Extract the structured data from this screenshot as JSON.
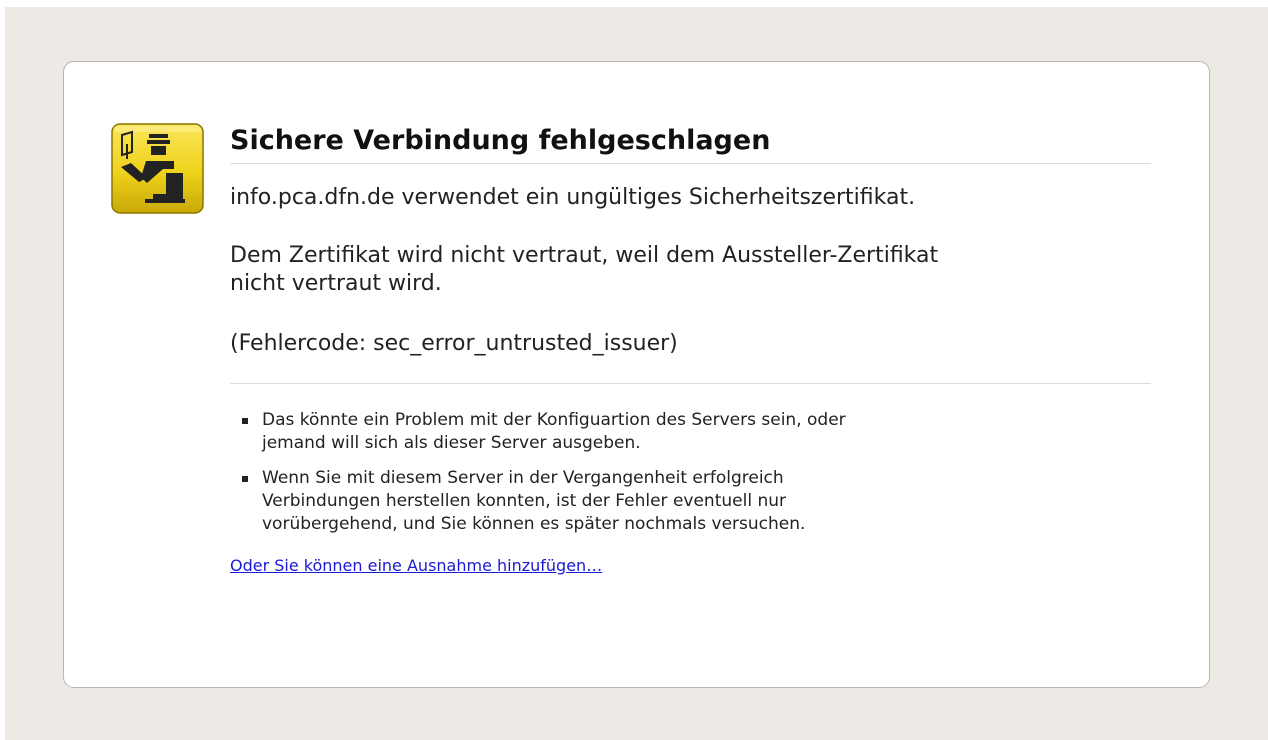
{
  "error_page": {
    "title": "Sichere Verbindung fehlgeschlagen",
    "short_desc": "info.pca.dfn.de verwendet ein ungültiges Sicherheitszertifikat.",
    "long_desc_line1": "Dem Zertifikat wird nicht vertraut, weil dem Aussteller-Zertifikat",
    "long_desc_line2": "nicht vertraut wird.",
    "error_code": "(Fehlercode: sec_error_untrusted_issuer)",
    "bullets": [
      {
        "line1": "Das könnte ein Problem mit der Konfiguartion des Servers sein, oder",
        "line2": "jemand will sich als dieser Server ausgeben."
      },
      {
        "line1": "Wenn Sie mit diesem Server in der Vergangenheit erfolgreich",
        "line2": "Verbindungen herstellen konnten, ist der Fehler eventuell nur",
        "line3": "vorübergehend, und Sie können es später nochmals versuchen."
      }
    ],
    "exception_link": "Oder Sie können eine Ausnahme hinzufügen…",
    "icon": "security-officer-icon"
  },
  "colors": {
    "page_background": "#edeae6",
    "box_background": "#ffffff",
    "box_border": "#b8b6b2",
    "icon_yellow": "#f0d81a",
    "link": "#1a1ad6",
    "text": "#222222"
  }
}
